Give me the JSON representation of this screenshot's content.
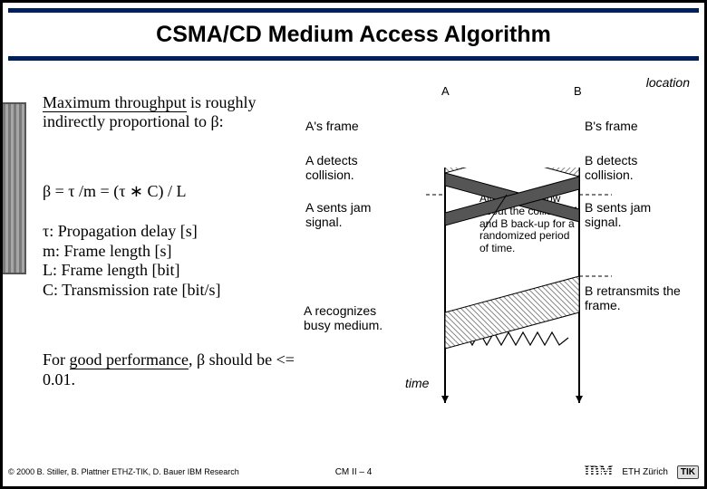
{
  "title": "CSMA/CD Medium Access Algorithm",
  "para1_pre": "Maximum throughput",
  "para1_post": " is roughly indirectly proportional to β:",
  "formula": "β = τ /m = (τ ∗ C) / L",
  "legend": {
    "tau": "τ:  Propagation delay [s]",
    "m": "m: Frame length [s]",
    "L": "L:  Frame length [bit]",
    "C": "C: Transmission rate [bit/s]"
  },
  "perf_pre": "For ",
  "perf_u": "good performance",
  "perf_post": ", β should be <= 0.01.",
  "labels": {
    "location": "location",
    "time": "time",
    "A_frame": "A's frame",
    "B_frame": "B's frame",
    "A_detects": "A detects collision.",
    "B_detects": "B detects collision.",
    "A_jam": "A sents jam signal.",
    "B_jam": "B sents jam signal.",
    "mid": "All stations know about the collision. A and B back-up for a randomized period of time.",
    "A_busy": "A recognizes busy medium.",
    "B_retx": "B retransmits the frame.",
    "A": "A",
    "B": "B"
  },
  "footer": {
    "copy": "© 2000  B. Stiller, B. Plattner ETHZ-TIK, D. Bauer IBM Research",
    "mid": "CM II – 4",
    "eth": "ETH Zürich",
    "ibm": "IBM",
    "tik": "TIK"
  }
}
